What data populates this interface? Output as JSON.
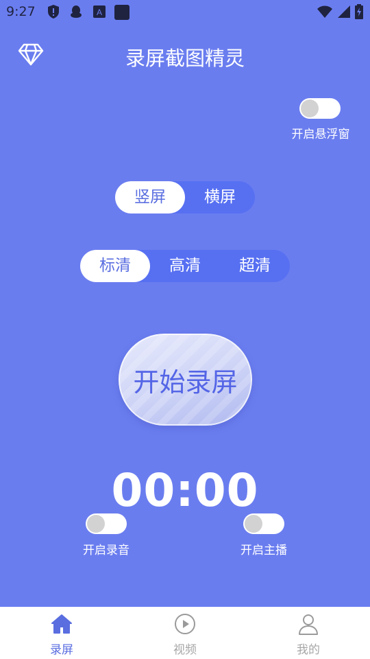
{
  "status_bar": {
    "time": "9:27",
    "left_icons": [
      "shield-icon",
      "qq-penguin-icon",
      "a-box-icon",
      "app-square-icon"
    ],
    "right_icons": [
      "wifi-icon",
      "cell-signal-icon",
      "battery-charging-icon"
    ]
  },
  "header": {
    "title": "录屏截图精灵",
    "icon": "diamond-icon"
  },
  "floating_window": {
    "label": "开启悬浮窗",
    "enabled": false
  },
  "orientation": {
    "options": [
      "竖屏",
      "横屏"
    ],
    "selected": "竖屏"
  },
  "quality": {
    "options": [
      "标清",
      "高清",
      "超清"
    ],
    "selected": "标清"
  },
  "record_button": {
    "label": "开始录屏"
  },
  "timer": {
    "value": "00:00"
  },
  "audio_toggle": {
    "label": "开启录音",
    "enabled": false
  },
  "stream_toggle": {
    "label": "开启主播",
    "enabled": false
  },
  "bottom_nav": {
    "items": [
      {
        "label": "录屏",
        "icon": "home-icon",
        "active": true
      },
      {
        "label": "视频",
        "icon": "play-circle-icon",
        "active": false
      },
      {
        "label": "我的",
        "icon": "person-icon",
        "active": false
      }
    ]
  },
  "colors": {
    "background": "#6a7def",
    "segment_track": "#5770f2",
    "accent": "#5a6ee0",
    "inactive_nav": "#a7a7a7"
  }
}
